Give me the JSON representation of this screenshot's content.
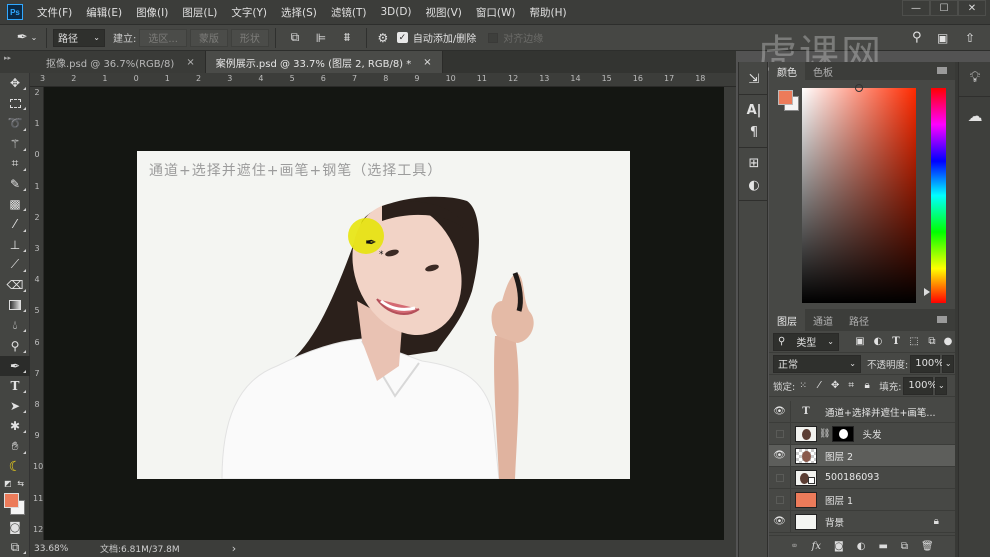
{
  "app": {
    "logo": "Ps"
  },
  "menu": [
    "文件(F)",
    "编辑(E)",
    "图像(I)",
    "图层(L)",
    "文字(Y)",
    "选择(S)",
    "滤镜(T)",
    "3D(D)",
    "视图(V)",
    "窗口(W)",
    "帮助(H)"
  ],
  "window_controls": {
    "minimize": "—",
    "maximize": "☐",
    "close": "✕"
  },
  "options_bar": {
    "tool_icon": "pen-icon",
    "mode_select": "路径",
    "make_label": "建立:",
    "buttons": [
      "选区...",
      "蒙版",
      "形状"
    ],
    "auto_add_delete_label": "自动添加/删除",
    "auto_add_delete_checked": true,
    "align_edges_label": "对齐边缘",
    "align_edges_checked": false
  },
  "watermark": "虎课网",
  "tabs": [
    {
      "label": "抠像.psd @ 36.7%(RGB/8)",
      "active": false,
      "close": "×"
    },
    {
      "label": "案例展示.psd @ 33.7% (图层 2, RGB/8) *",
      "active": true,
      "close": "×"
    }
  ],
  "tools": [
    "move",
    "marquee",
    "lasso",
    "magic-wand",
    "crop",
    "eyedropper",
    "healing",
    "brush",
    "stamp",
    "history-brush",
    "eraser",
    "gradient",
    "blur",
    "dodge",
    "pen",
    "type",
    "path-select",
    "shape",
    "hand",
    "banana",
    "swap",
    "quick-mask",
    "screen-mode"
  ],
  "ruler_top": [
    "3",
    "2",
    "1",
    "0",
    "1",
    "2",
    "3",
    "4",
    "5",
    "6",
    "7",
    "8",
    "9",
    "10",
    "11",
    "12",
    "13",
    "14",
    "15",
    "16",
    "17",
    "18"
  ],
  "ruler_left": [
    "2",
    "1",
    "0",
    "1",
    "2",
    "3",
    "4",
    "5",
    "6",
    "7",
    "8",
    "9",
    "10",
    "11",
    "12"
  ],
  "canvas": {
    "title_text": "通道+选择并遮住+画笔+钢笔（选择工具）",
    "background_color": "#f4f5f2"
  },
  "status": {
    "zoom": "33.68%",
    "doc": "文档:6.81M/37.8M",
    "arrow": "›"
  },
  "color_panel": {
    "tabs": [
      "颜色",
      "色板"
    ],
    "foreground": "#ec7b5a",
    "background": "#f5f5f5"
  },
  "layers_panel": {
    "tabs": [
      "图层",
      "通道",
      "路径"
    ],
    "filter_label": "类型",
    "blend_mode": "正常",
    "opacity_label": "不透明度:",
    "opacity_value": "100%",
    "lock_label": "锁定:",
    "fill_label": "填充:",
    "fill_value": "100%",
    "layers": [
      {
        "name": "通道+选择并遮住+画笔...",
        "visible": true,
        "type": "text",
        "selected": false
      },
      {
        "name": "头发",
        "visible": false,
        "type": "masked",
        "selected": false
      },
      {
        "name": "图层 2",
        "visible": true,
        "type": "pixel",
        "selected": true
      },
      {
        "name": "500186093",
        "visible": false,
        "type": "smart",
        "selected": false
      },
      {
        "name": "图层 1",
        "visible": false,
        "type": "fill",
        "selected": false,
        "color": "#ec7b5a"
      },
      {
        "name": "背景",
        "visible": true,
        "type": "background",
        "selected": false,
        "locked": true
      }
    ]
  }
}
